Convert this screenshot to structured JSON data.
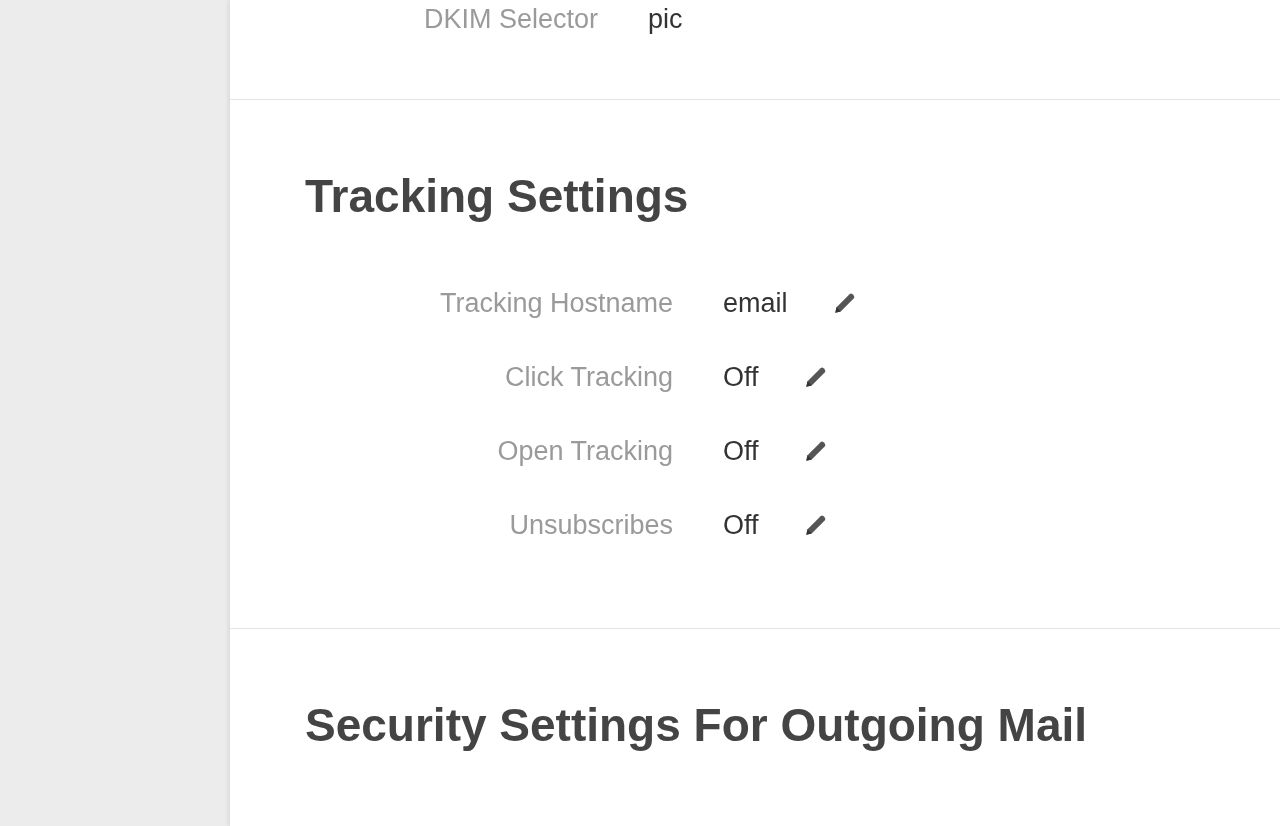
{
  "top_rows": [
    {
      "label": "DKIM Selector",
      "value": "pic"
    }
  ],
  "sections": [
    {
      "title": "Tracking Settings",
      "rows": [
        {
          "label": "Tracking Hostname",
          "value": "email"
        },
        {
          "label": "Click Tracking",
          "value": "Off"
        },
        {
          "label": "Open Tracking",
          "value": "Off"
        },
        {
          "label": "Unsubscribes",
          "value": "Off"
        }
      ]
    },
    {
      "title": "Security Settings For Outgoing Mail"
    }
  ]
}
